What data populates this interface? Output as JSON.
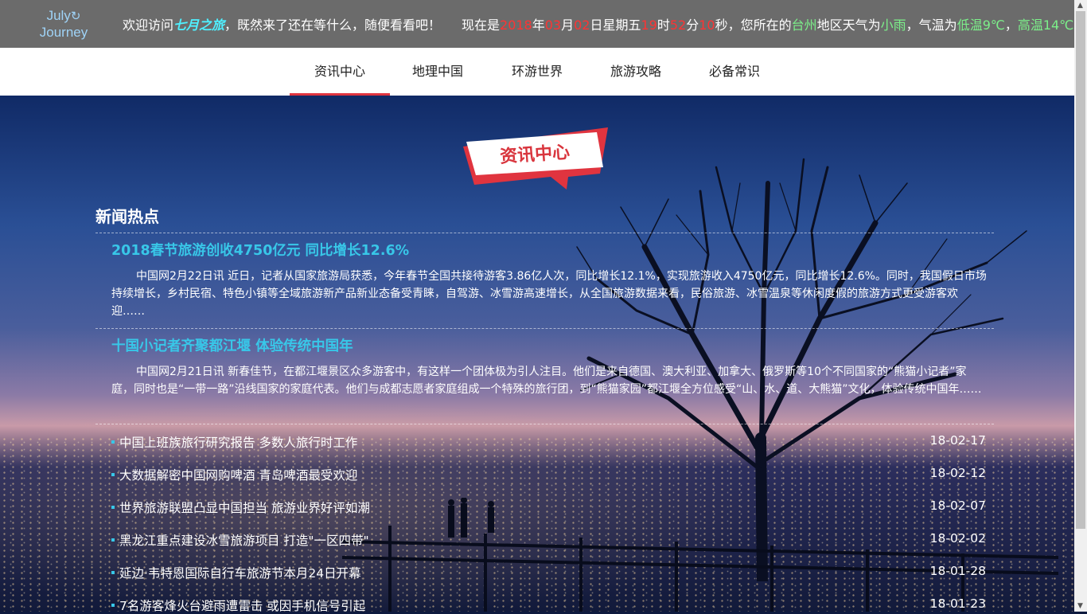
{
  "header": {
    "logo_line1": "July",
    "logo_line2": "Journey",
    "welcome_prefix": "欢迎访问",
    "site_name": "七月之旅",
    "welcome_suffix": "，既然来了还在等什么，随便看看吧！",
    "time_prefix": "现在是",
    "year": "2018",
    "year_unit": "年",
    "month": "03",
    "month_unit": "月",
    "day": "02",
    "day_unit": "日星期五",
    "hour": "19",
    "hour_unit": "时",
    "minute": "52",
    "minute_unit": "分",
    "second": "10",
    "second_unit": "秒，您所在的",
    "city": "台州",
    "region_suffix": "地区天气为",
    "weather": "小雨",
    "temp_prefix": "，气温为",
    "low_temp": "低温9℃",
    "comma": "，",
    "high_temp": "高温14℃",
    "end": "。"
  },
  "nav": {
    "items": [
      "资讯中心",
      "地理中国",
      "环游世界",
      "旅游攻略",
      "必备常识"
    ],
    "active_index": 0
  },
  "badge": {
    "label": "资讯中心"
  },
  "news": {
    "section_title": "新闻热点",
    "featured": [
      {
        "title": "2018春节旅游创收4750亿元 同比增长12.6%",
        "body": "中国网2月22日讯 近日，记者从国家旅游局获悉，今年春节全国共接待游客3.86亿人次，同比增长12.1%，实现旅游收入4750亿元，同比增长12.6%。同时，我国假日市场持续增长，乡村民宿、特色小镇等全域旅游新产品新业态备受青睐，自驾游、冰雪游高速增长，从全国旅游数据来看，民俗旅游、冰雪温泉等休闲度假的旅游方式更受游客欢迎……"
      },
      {
        "title": "十国小记者齐聚都江堰 体验传统中国年",
        "body": "中国网2月21日讯 新春佳节，在都江堰景区众多游客中，有这样一个团体极为引人注目。他们是来自德国、澳大利亚、加拿大、俄罗斯等10个不同国家的“熊猫小记者”家庭，同时也是“一带一路”沿线国家的家庭代表。他们与成都志愿者家庭组成一个特殊的旅行团，到“熊猫家园”都江堰全方位感受“山、水、道、大熊猫”文化，体验传统中国年……"
      }
    ],
    "list": [
      {
        "title": "中国上班族旅行研究报告 多数人旅行时工作",
        "date": "18-02-17"
      },
      {
        "title": "大数据解密中国网购啤酒 青岛啤酒最受欢迎",
        "date": "18-02-12"
      },
      {
        "title": "世界旅游联盟凸显中国担当 旅游业界好评如潮",
        "date": "18-02-07"
      },
      {
        "title": "黑龙江重点建设冰雪旅游项目 打造\"一区四带\"",
        "date": "18-02-02"
      },
      {
        "title": "延边·韦特恩国际自行车旅游节本月24日开幕",
        "date": "18-01-28"
      },
      {
        "title": "7名游客烽火台避雨遭雷击 或因手机信号引起",
        "date": "18-01-23"
      }
    ]
  },
  "colors": {
    "topbar_bg": "#6b6b6b",
    "accent_red": "#e0343f",
    "accent_cyan": "#38c7e8",
    "highlight_green": "#7cf08a"
  }
}
